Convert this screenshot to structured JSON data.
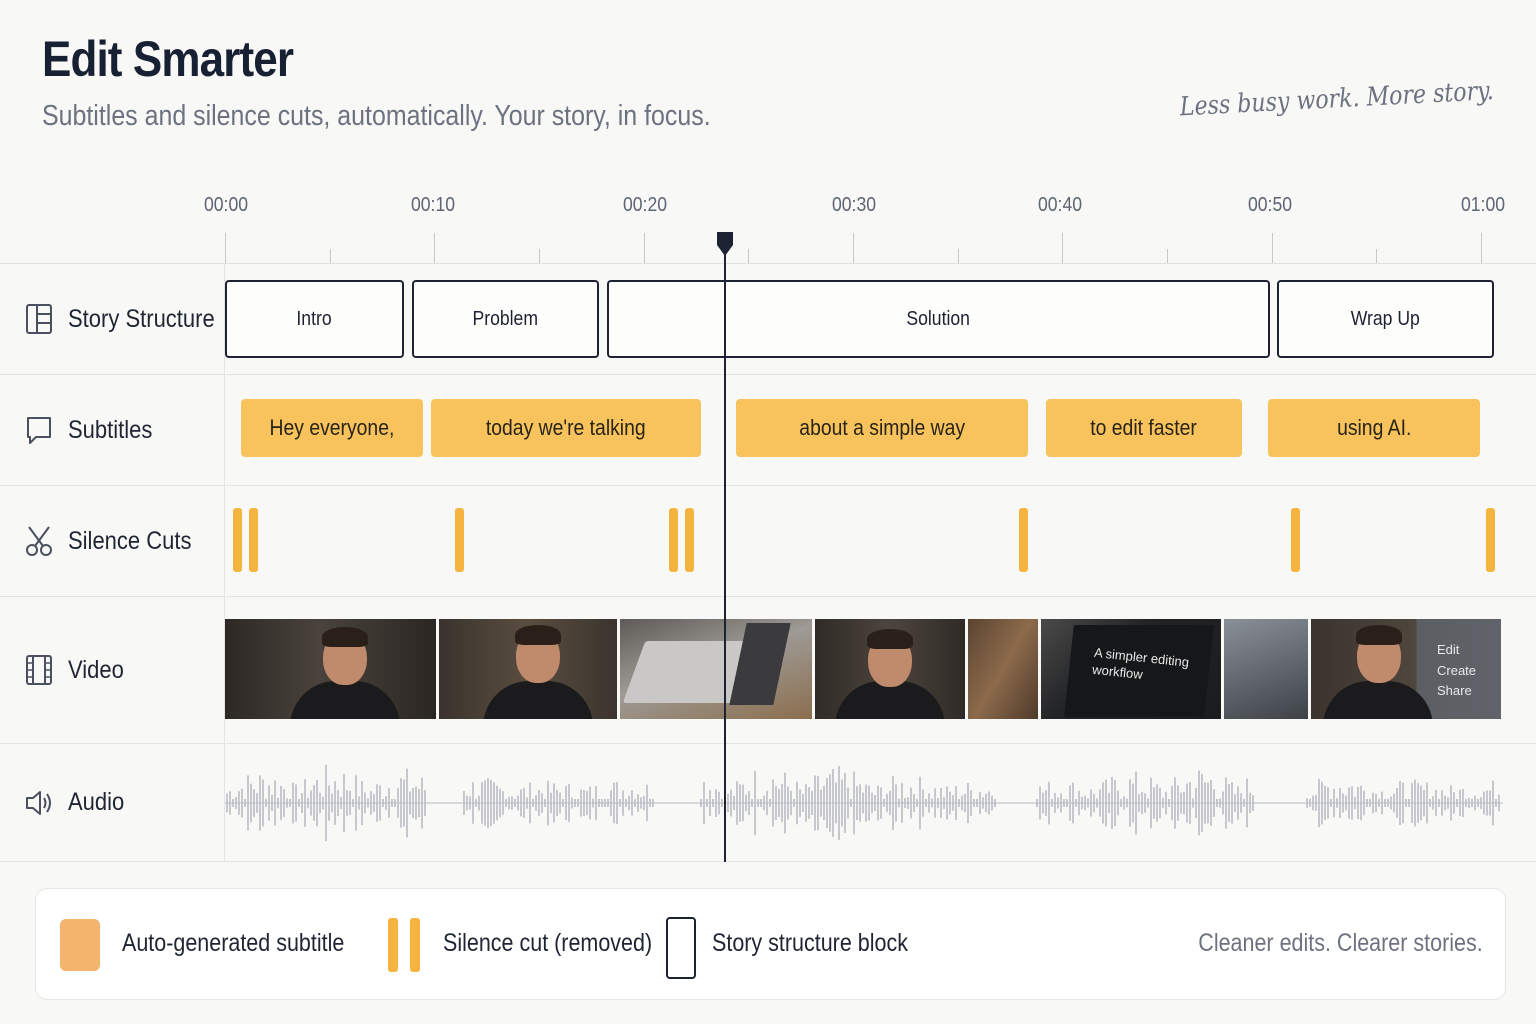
{
  "header": {
    "title": "Edit Smarter",
    "subtitle": "Subtitles and silence cuts, automatically. Your story, in focus.",
    "tagline": "Less busy work. More story."
  },
  "ruler": {
    "labels": [
      "00:00",
      "00:10",
      "00:20",
      "00:30",
      "00:40",
      "00:50",
      "01:00"
    ]
  },
  "playhead": {
    "time": "00:23"
  },
  "tracks": {
    "story": {
      "label": "Story Structure",
      "icon": "layout-columns-icon",
      "blocks": [
        "Intro",
        "Problem",
        "Solution",
        "Wrap Up"
      ]
    },
    "subtitles": {
      "label": "Subtitles",
      "icon": "speech-bubble-icon",
      "color": "#f8c35d",
      "chips": [
        "Hey everyone,",
        "today we're talking",
        "about a simple way",
        "to edit faster",
        "using AI."
      ]
    },
    "silence": {
      "label": "Silence Cuts",
      "icon": "scissors-icon",
      "color": "#f4b43f"
    },
    "video": {
      "label": "Video",
      "icon": "film-strip-icon",
      "screen_text_1": "A simpler editing workflow",
      "screen_text_2": [
        "Edit",
        "Create",
        "Share"
      ]
    },
    "audio": {
      "label": "Audio",
      "icon": "speaker-icon",
      "color": "#b9bcc4"
    }
  },
  "legend": {
    "subtitle_label": "Auto-generated subtitle",
    "silence_label": "Silence cut (removed)",
    "story_label": "Story structure block",
    "tagline": "Cleaner edits. Clearer stories.",
    "subtitle_swatch_color": "#f4b46d"
  }
}
